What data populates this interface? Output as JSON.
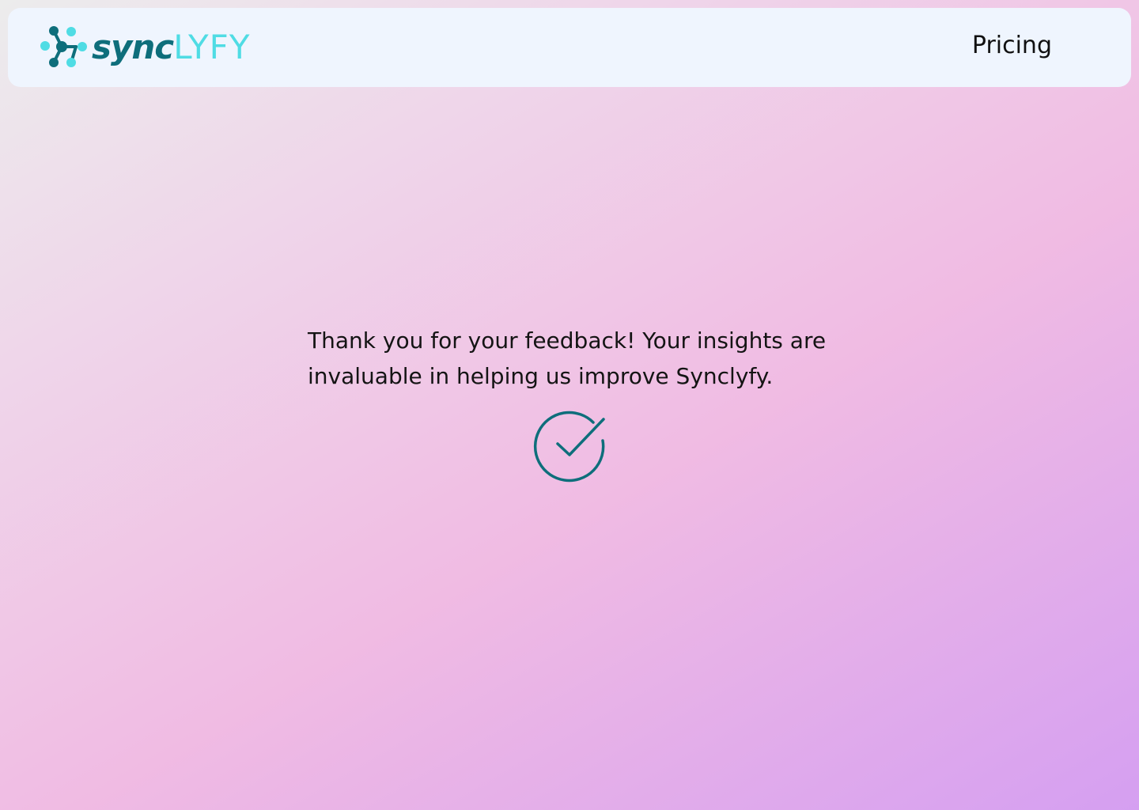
{
  "header": {
    "logo": {
      "word_bold": "sync",
      "word_light": "LYFY",
      "icon": "molecule-logo-icon",
      "colors": {
        "primary": "#0e6e7b",
        "accent": "#4fdce4"
      }
    },
    "nav": {
      "pricing_label": "Pricing"
    }
  },
  "main": {
    "message": "Thank you for your feedback! Your insights are invaluable in helping us improve Synclyfy.",
    "status_icon": "check-circle-icon",
    "status_color": "#0e6e7b"
  },
  "theme": {
    "header_bg": "#eff5fe",
    "gradient": [
      "#ececec",
      "#efd6ea",
      "#f0bbe3",
      "#d59ff1"
    ]
  }
}
